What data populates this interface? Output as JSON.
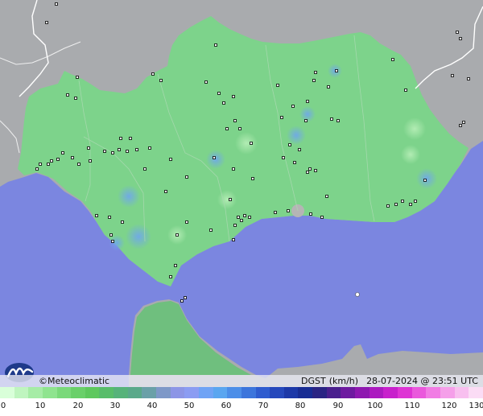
{
  "brand": {
    "copyright_symbol": "©",
    "name": "Meteoclimatic",
    "logo_icon": "meteoclimatic-logo-icon"
  },
  "product": {
    "variable": "DGST",
    "unit": "(km/h)",
    "datetime": "28-07-2024 @ 23:51 UTC"
  },
  "legend": {
    "ticks": [
      "0",
      "10",
      "20",
      "30",
      "40",
      "50",
      "60",
      "70",
      "80",
      "90",
      "100",
      "110",
      "120",
      "130"
    ],
    "colors": [
      "#d9ffd9",
      "#bff5bf",
      "#a6eca6",
      "#8fe48f",
      "#7ad97a",
      "#6ad06a",
      "#5ec85e",
      "#58bd6a",
      "#56b37a",
      "#5aa98a",
      "#6aa0a8",
      "#7e98c8",
      "#8c95e6",
      "#8b9cf2",
      "#6fa3f5",
      "#5aa6f0",
      "#4c8ee8",
      "#3c75dc",
      "#2f5ccf",
      "#2548bc",
      "#1c38a8",
      "#182c94",
      "#2a2484",
      "#4a1f8e",
      "#6e1aa0",
      "#8e18b0",
      "#ac1ac0",
      "#c820cc",
      "#de34d4",
      "#ea58dc",
      "#f17ce4",
      "#f59fe9",
      "#f8bfef",
      "#fbdcf5"
    ],
    "colors_named": {
      "sea": "#7b86e0",
      "land_green": "#7dd38b",
      "outside_grey": "#a9abae"
    }
  }
}
